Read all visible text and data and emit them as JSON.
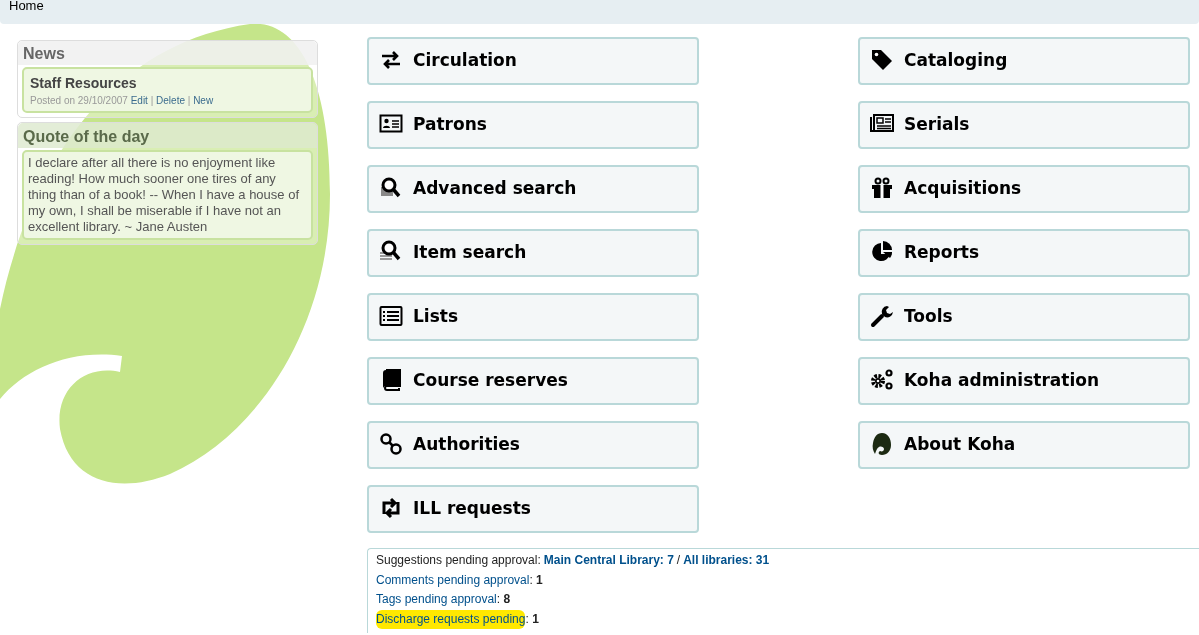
{
  "breadcrumb": "Home",
  "news": {
    "title": "News",
    "items": [
      {
        "title": "Staff Resources",
        "posted": "Posted on 29/10/2007",
        "actions": [
          "Edit",
          "Delete",
          "New"
        ],
        "action_separator": "|"
      }
    ]
  },
  "quote": {
    "title": "Quote of the day",
    "text": "I declare after all there is no enjoyment like reading! How much sooner one tires of any thing than of a book! -- When I have a house of my own, I shall be miserable if I have not an excellent library. ~ Jane Austen"
  },
  "modules_left": [
    {
      "label": "Circulation"
    },
    {
      "label": "Patrons"
    },
    {
      "label": "Advanced search"
    },
    {
      "label": "Item search"
    },
    {
      "label": "Lists"
    },
    {
      "label": "Course reserves"
    },
    {
      "label": "Authorities"
    },
    {
      "label": "ILL requests"
    }
  ],
  "modules_right": [
    {
      "label": "Cataloging"
    },
    {
      "label": "Serials"
    },
    {
      "label": "Acquisitions"
    },
    {
      "label": "Reports"
    },
    {
      "label": "Tools"
    },
    {
      "label": "Koha administration"
    },
    {
      "label": "About Koha"
    }
  ],
  "pending": [
    {
      "kind": "split",
      "label": "Suggestions pending approval:",
      "links": [
        "Main Central Library: 7",
        "All libraries: 31"
      ],
      "separator": "/",
      "highlighted": false
    },
    {
      "kind": "count",
      "link": "Comments pending approval",
      "punct": ":",
      "count": "1",
      "highlighted": false
    },
    {
      "kind": "count",
      "link": "Tags pending approval",
      "punct": ":",
      "count": "8",
      "highlighted": false
    },
    {
      "kind": "count",
      "link": "Discharge requests pending",
      "punct": ":",
      "count": "1",
      "highlighted": true
    }
  ]
}
